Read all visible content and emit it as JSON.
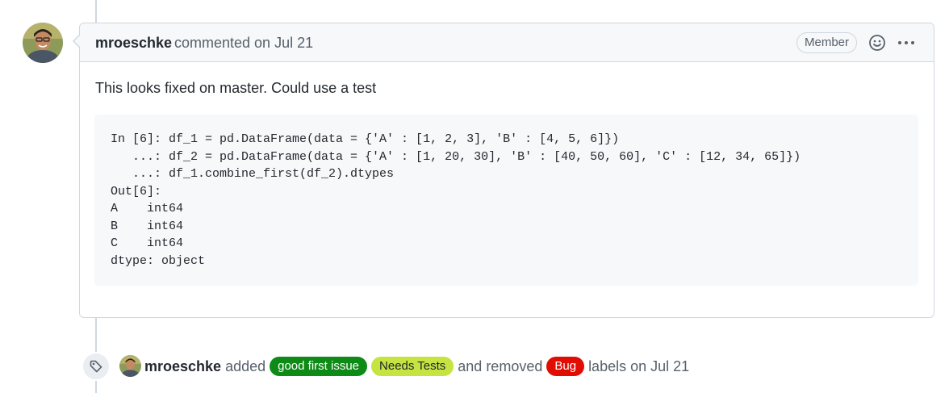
{
  "comment": {
    "author": "mroeschke",
    "action": "commented on Jul 21",
    "badge": "Member",
    "body": "This looks fixed on master. Could use a test",
    "code": "In [6]: df_1 = pd.DataFrame(data = {'A' : [1, 2, 3], 'B' : [4, 5, 6]})\n   ...: df_2 = pd.DataFrame(data = {'A' : [1, 20, 30], 'B' : [40, 50, 60], 'C' : [12, 34, 65]})\n   ...: df_1.combine_first(df_2).dtypes\nOut[6]:\nA    int64\nB    int64\nC    int64\ndtype: object"
  },
  "event": {
    "author": "mroeschke",
    "added_text": "added",
    "labels_added": [
      {
        "name": "good first issue",
        "bg": "#0e8a16",
        "fg": "#ffffff"
      },
      {
        "name": "Needs Tests",
        "bg": "#c5e442",
        "fg": "#1f2328"
      }
    ],
    "removed_text": "and removed",
    "labels_removed": [
      {
        "name": "Bug",
        "bg": "#e10c02",
        "fg": "#ffffff"
      }
    ],
    "suffix": "labels on Jul 21"
  },
  "icons": {
    "emoji": "smiley-icon",
    "more": "kebab-horizontal-icon",
    "tag": "tag-icon"
  }
}
